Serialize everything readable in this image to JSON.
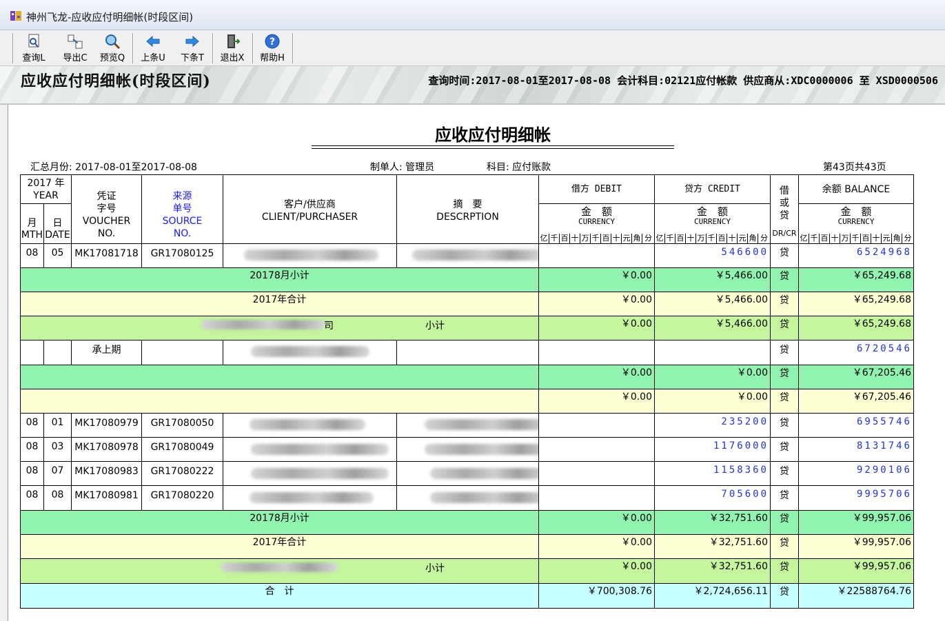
{
  "window": {
    "title": "神州飞龙-应收应付明细帐(时段区间)"
  },
  "toolbar": {
    "query": "查询L",
    "export": "导出C",
    "preview": "预览Q",
    "prev": "上条U",
    "next": "下条T",
    "exit": "退出X",
    "help": "帮助H"
  },
  "banner": {
    "title": "应收应付明细帐(时段区间)",
    "info": "查询时间:2017-08-01至2017-08-08 会计科目:02121应付帐款 供应商从:XDC0000006 至 XSD0000506"
  },
  "report": {
    "title": "应收应付明细帐",
    "period": "汇总月份: 2017-08-01至2017-08-08",
    "maker": "制单人: 管理员",
    "subject": "科目: 应付账款",
    "page": "第43页共43页"
  },
  "headers": {
    "year_num": "2017 年",
    "year_en": "YEAR",
    "month": "月",
    "day": "日",
    "mth": "MTH",
    "date": "DATE",
    "voucher_cn1": "凭证",
    "voucher_cn2": "字号",
    "voucher_en1": "VOUCHER",
    "voucher_en2": "NO.",
    "source_cn1": "来源",
    "source_cn2": "单号",
    "source_en1": "SOURCE",
    "source_en2": "NO.",
    "client_cn": "客户/供应商",
    "client_en": "CLIENT/PURCHASER",
    "desc_cn": "摘　要",
    "desc_en": "DESCRPTION",
    "debit": "借方 DEBIT",
    "credit": "贷方 CREDIT",
    "balance": "余额 BALANCE",
    "amount_cn": "金　额",
    "currency": "CURRENCY",
    "dir_cn1": "借",
    "dir_cn2": "或",
    "dir_cn3": "贷",
    "dir_en": "DR/CR",
    "ticks": [
      "亿",
      "千",
      "百",
      "十",
      "万",
      "千",
      "百",
      "十",
      "元",
      "角",
      "分"
    ]
  },
  "rows": {
    "r1": {
      "month": "08",
      "day": "05",
      "voucher": "MK17081718",
      "source": "GR17080125",
      "credit": "546600",
      "dir": "贷",
      "balance": "6524968"
    },
    "r2": {
      "label": "20178月小计",
      "debit": "￥0.00",
      "credit": "￥5,466.00",
      "dir": "贷",
      "balance": "￥65,249.68"
    },
    "r3": {
      "label": "2017年合计",
      "debit": "￥0.00",
      "credit": "￥5,466.00",
      "dir": "贷",
      "balance": "￥65,249.68"
    },
    "r4": {
      "suffix": "司",
      "label": "小计",
      "debit": "￥0.00",
      "credit": "￥5,466.00",
      "dir": "贷",
      "balance": "￥65,249.68"
    },
    "r5": {
      "voucher": "承上期",
      "dir": "贷",
      "balance": "6720546"
    },
    "r6": {
      "debit": "￥0.00",
      "credit": "￥0.00",
      "dir": "贷",
      "balance": "￥67,205.46"
    },
    "r7": {
      "debit": "￥0.00",
      "credit": "￥0.00",
      "dir": "贷",
      "balance": "￥67,205.46"
    },
    "r8": {
      "month": "08",
      "day": "01",
      "voucher": "MK17080979",
      "source": "GR17080050",
      "credit": "235200",
      "dir": "贷",
      "balance": "6955746"
    },
    "r9": {
      "month": "08",
      "day": "03",
      "voucher": "MK17080978",
      "source": "GR17080049",
      "credit": "1176000",
      "dir": "贷",
      "balance": "8131746"
    },
    "r10": {
      "month": "08",
      "day": "07",
      "voucher": "MK17080983",
      "source": "GR17080222",
      "credit": "1158360",
      "dir": "贷",
      "balance": "9290106"
    },
    "r11": {
      "month": "08",
      "day": "08",
      "voucher": "MK17080981",
      "source": "GR17080220",
      "credit": "705600",
      "dir": "贷",
      "balance": "9995706"
    },
    "r12": {
      "label": "20178月小计",
      "debit": "￥0.00",
      "credit": "￥32,751.60",
      "dir": "贷",
      "balance": "￥99,957.06"
    },
    "r13": {
      "label": "2017年合计",
      "debit": "￥0.00",
      "credit": "￥32,751.60",
      "dir": "贷",
      "balance": "￥99,957.06"
    },
    "r14": {
      "label": "小计",
      "debit": "￥0.00",
      "credit": "￥32,751.60",
      "dir": "贷",
      "balance": "￥99,957.06"
    },
    "r15": {
      "label": "合　计",
      "debit": "￥700,308.76",
      "credit": "￥2,724,656.11",
      "dir": "贷",
      "balance": "￥22588764.76"
    }
  },
  "colors": {
    "subtotal": "#90f3b0",
    "yeartotal": "#ffffd4",
    "partytotal": "#c5f59d",
    "grandtotal": "#c6ffff",
    "digits": "#2233dd"
  }
}
